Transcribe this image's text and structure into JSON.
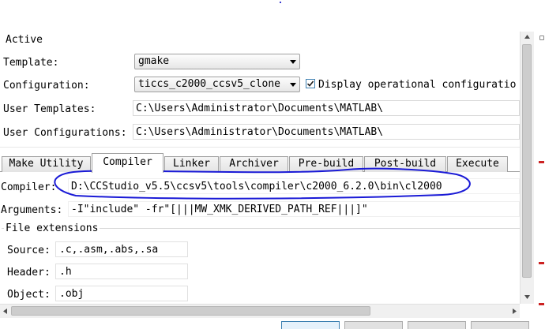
{
  "section": {
    "title": "Active"
  },
  "fields": {
    "template_label": "Template:",
    "template_value": "gmake",
    "configuration_label": "Configuration:",
    "configuration_value": "ticcs_c2000_ccsv5_clone",
    "display_checkbox_label": "Display operational configuratio",
    "display_checked": true,
    "user_templates_label": "User Templates:",
    "user_templates_value": "C:\\Users\\Administrator\\Documents\\MATLAB\\",
    "user_configs_label": "User Configurations:",
    "user_configs_value": "C:\\Users\\Administrator\\Documents\\MATLAB\\"
  },
  "tabs": [
    {
      "label": "Make Utility"
    },
    {
      "label": "Compiler",
      "active": true
    },
    {
      "label": "Linker"
    },
    {
      "label": "Archiver"
    },
    {
      "label": "Pre-build"
    },
    {
      "label": "Post-build"
    },
    {
      "label": "Execute"
    }
  ],
  "compiler": {
    "compiler_label": "Compiler:",
    "compiler_value": "D:\\CCStudio_v5.5\\ccsv5\\tools\\compiler\\c2000_6.2.0\\bin\\cl2000",
    "arguments_label": "Arguments:",
    "arguments_value": "-I\"include\" -fr\"[|||MW_XMK_DERIVED_PATH_REF|||]\""
  },
  "extensions": {
    "title": "File extensions",
    "source_label": "Source:",
    "source_value": ".c,.asm,.abs,.sa",
    "header_label": "Header:",
    "header_value": ".h",
    "object_label": "Object:",
    "object_value": ".obj"
  },
  "colors": {
    "annotation": "#1a1ad6",
    "edge_marks": "#cc2222",
    "checkbox_border": "#3c7fb1"
  },
  "icons": {
    "scroll_up": "triangle-up",
    "scroll_down": "triangle-down",
    "scroll_left": "triangle-left",
    "scroll_right": "triangle-right",
    "checkbox_checked": "check-mark",
    "combo_arrow": "triangle-down"
  }
}
